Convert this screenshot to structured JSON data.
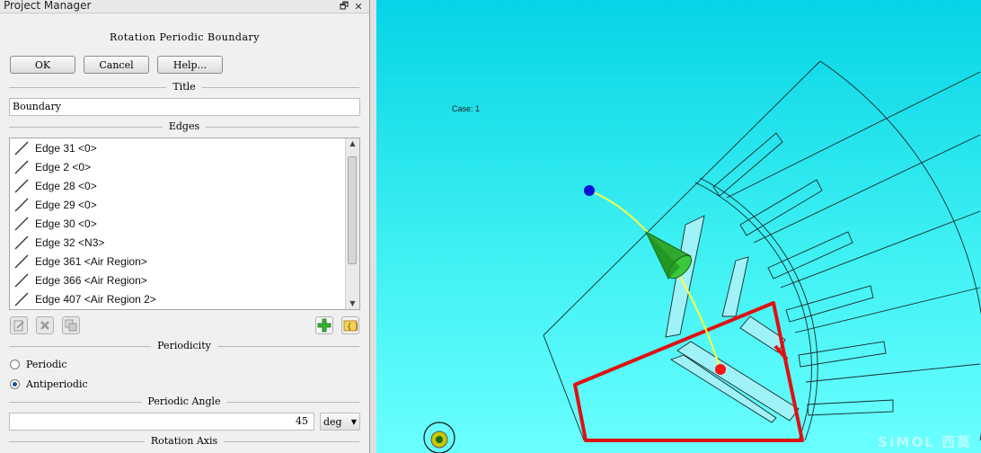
{
  "window": {
    "title": "Project Manager",
    "restore_glyph": "🗗",
    "close_glyph": "✕"
  },
  "dialog": {
    "title": "Rotation Periodic Boundary",
    "ok_label": "OK",
    "cancel_label": "Cancel",
    "help_label": "Help...",
    "title_section": "Title",
    "title_value": "Boundary",
    "edges_section": "Edges",
    "edges": [
      {
        "label": "Edge 31 <0>"
      },
      {
        "label": "Edge 2 <0>"
      },
      {
        "label": "Edge 28 <0>"
      },
      {
        "label": "Edge 29 <0>"
      },
      {
        "label": "Edge 30 <0>"
      },
      {
        "label": "Edge 32 <N3>"
      },
      {
        "label": "Edge 361 <Air Region>"
      },
      {
        "label": "Edge 366 <Air Region>"
      },
      {
        "label": "Edge 407 <Air Region 2>"
      }
    ],
    "tools": [
      "edit-icon",
      "delete-icon",
      "copy-icon",
      "add-edge-icon",
      "select-edge-icon"
    ],
    "periodicity_section": "Periodicity",
    "periodic_label": "Periodic",
    "antiperiodic_label": "Antiperiodic",
    "periodicity_selected": "Antiperiodic",
    "angle_section": "Periodic Angle",
    "angle_value": "45",
    "angle_unit": "deg",
    "axis_section": "Rotation Axis"
  },
  "viewport": {
    "case_label": "Case: 1",
    "background": "#2ee6f0",
    "boundary_color": "#e01010",
    "watermark": "SIMOL 西莫"
  }
}
